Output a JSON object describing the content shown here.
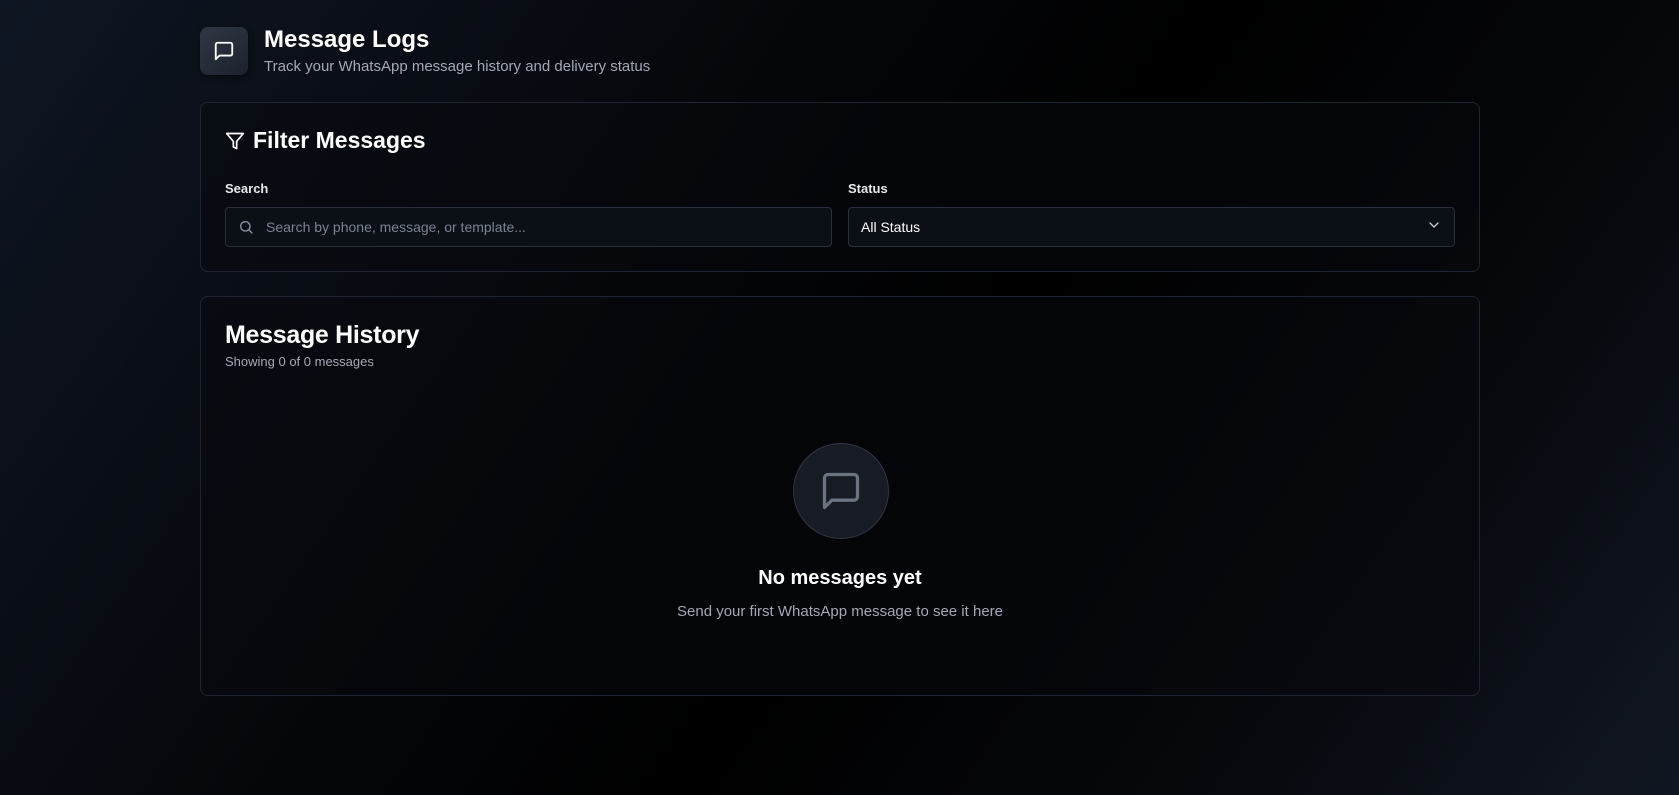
{
  "header": {
    "icon": "message-square-icon",
    "title": "Message Logs",
    "subtitle": "Track your WhatsApp message history and delivery status"
  },
  "filter": {
    "icon": "filter-icon",
    "title": "Filter Messages",
    "search": {
      "label": "Search",
      "icon": "search-icon",
      "placeholder": "Search by phone, message, or template...",
      "value": ""
    },
    "status": {
      "label": "Status",
      "selected": "All Status",
      "icon": "chevron-down-icon"
    }
  },
  "history": {
    "title": "Message History",
    "count_text": "Showing 0 of 0 messages",
    "empty": {
      "icon": "message-square-icon",
      "title": "No messages yet",
      "subtitle": "Send your first WhatsApp message to see it here"
    }
  },
  "colors": {
    "background": "#000000",
    "card_border": "#1f2530",
    "muted_text": "#a3a9b4",
    "input_bg": "#0b0f16"
  }
}
